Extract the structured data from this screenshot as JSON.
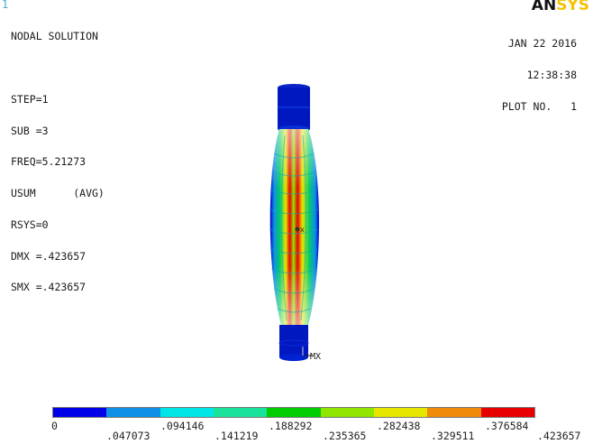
{
  "window_number": "1",
  "logo": {
    "an": "AN",
    "sys": "SYS"
  },
  "info": {
    "lines": [
      "NODAL SOLUTION",
      "",
      "STEP=1",
      "SUB =3",
      "FREQ=5.21273",
      "USUM      (AVG)",
      "RSYS=0",
      "DMX =.423657",
      "SMX =.423657"
    ]
  },
  "date_block": {
    "date": "JAN 22 2016",
    "time": "12:38:38",
    "plot": "PLOT NO.   1"
  },
  "model": {
    "axis_label": "MX"
  },
  "legend": {
    "colors": [
      "#0000e6",
      "#0f8fe6",
      "#00e6e6",
      "#19e39b",
      "#00cc00",
      "#91e600",
      "#e6e600",
      "#f08a0a",
      "#e60000"
    ],
    "ticks": [
      {
        "label": "0",
        "row": "top"
      },
      {
        "label": ".047073",
        "row": "bottom"
      },
      {
        "label": ".094146",
        "row": "top"
      },
      {
        "label": ".141219",
        "row": "bottom"
      },
      {
        "label": ".188292",
        "row": "top"
      },
      {
        "label": ".235365",
        "row": "bottom"
      },
      {
        "label": ".282438",
        "row": "top"
      },
      {
        "label": ".329511",
        "row": "bottom"
      },
      {
        "label": ".376584",
        "row": "top"
      },
      {
        "label": ".423657",
        "row": "bottom"
      }
    ]
  }
}
